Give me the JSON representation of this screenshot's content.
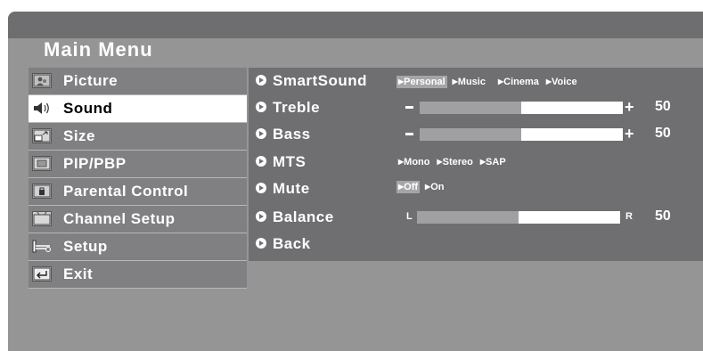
{
  "title": "Main Menu",
  "menu": [
    {
      "label": "Picture",
      "icon": "picture-icon",
      "selected": false
    },
    {
      "label": "Sound",
      "icon": "speaker-icon",
      "selected": true
    },
    {
      "label": "Size",
      "icon": "size-icon",
      "selected": false
    },
    {
      "label": "PIP/PBP",
      "icon": "pip-icon",
      "selected": false
    },
    {
      "label": "Parental  Control",
      "icon": "lock-icon",
      "selected": false
    },
    {
      "label": "Channel  Setup",
      "icon": "channel-icon",
      "selected": false
    },
    {
      "label": "Setup",
      "icon": "wrench-icon",
      "selected": false
    },
    {
      "label": "Exit",
      "icon": "return-icon",
      "selected": false
    }
  ],
  "sound": {
    "smartsound": {
      "label": "SmartSound",
      "options": [
        "Personal",
        "Music",
        "Cinema",
        "Voice"
      ],
      "selected": "Personal"
    },
    "treble": {
      "label": "Treble",
      "level": 0.5,
      "value": "50",
      "minus": "−",
      "plus": "+"
    },
    "bass": {
      "label": "Bass",
      "level": 0.5,
      "value": "50",
      "minus": "−",
      "plus": "+"
    },
    "mts": {
      "label": "MTS",
      "options": [
        "Mono",
        "Stereo",
        "SAP"
      ],
      "selected": ""
    },
    "mute": {
      "label": "Mute",
      "options": [
        "Off",
        "On"
      ],
      "selected": "Off"
    },
    "balance": {
      "label": "Balance",
      "left_label": "L",
      "right_label": "R",
      "level": 0.5,
      "value": "50"
    },
    "back": {
      "label": "Back"
    }
  },
  "colors": {
    "osd_bg": "#959596",
    "submenu_bg": "#6f6f71",
    "menu_item_bg": "#808083",
    "selected_bg": "#ffffff"
  }
}
